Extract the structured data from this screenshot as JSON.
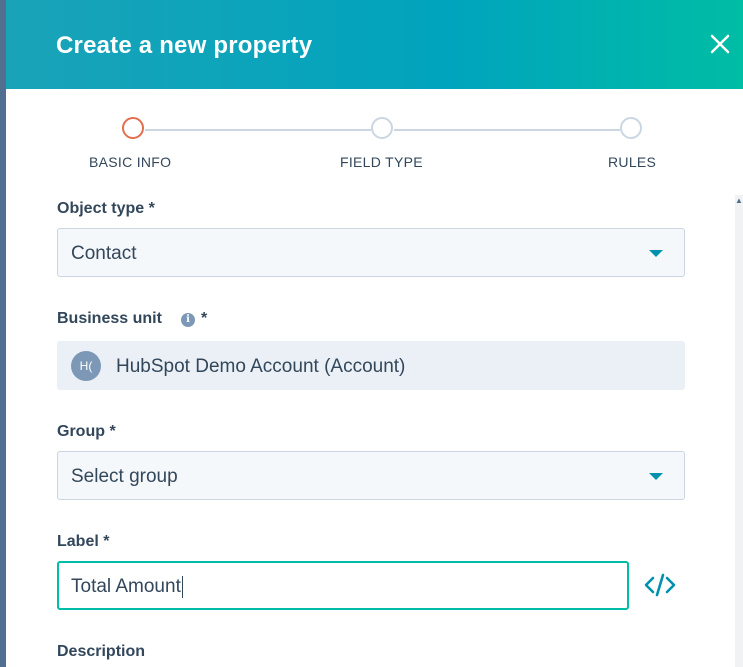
{
  "dialog": {
    "title": "Create a new property"
  },
  "stepper": {
    "steps": [
      {
        "label": "BASIC INFO",
        "active": true
      },
      {
        "label": "FIELD TYPE",
        "active": false
      },
      {
        "label": "RULES",
        "active": false
      }
    ]
  },
  "form": {
    "object_type": {
      "label": "Object type *",
      "value": "Contact"
    },
    "business_unit": {
      "label": "Business unit",
      "required_mark": "*",
      "avatar_initials": "H(",
      "value": "HubSpot Demo Account (Account)"
    },
    "group": {
      "label": "Group *",
      "placeholder": "Select group"
    },
    "label": {
      "label": "Label *",
      "value": "Total Amount"
    },
    "description": {
      "label": "Description"
    }
  },
  "colors": {
    "header_gradient_start": "#1aa3b8",
    "header_gradient_end": "#00bda5",
    "active_step": "#e66e50",
    "focus_border": "#00bda5",
    "accent": "#0091ae"
  },
  "icons": {
    "close": "close-icon",
    "info": "info-icon",
    "dropdown": "chevron-down-icon",
    "code": "code-icon"
  }
}
